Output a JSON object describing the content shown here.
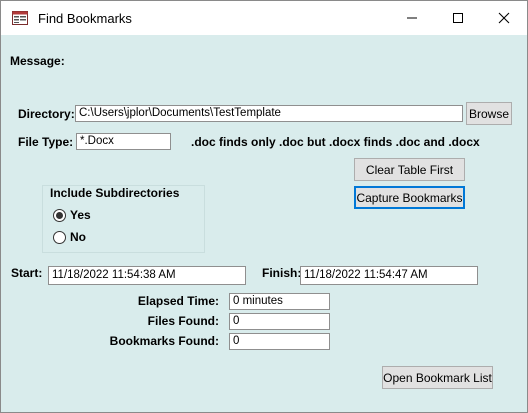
{
  "window": {
    "title": "Find Bookmarks"
  },
  "labels": {
    "message": "Message:",
    "directory": "Directory:",
    "file_type": "File Type:",
    "hint": ".doc finds only .doc but .docx finds .doc and .docx",
    "include_subdirectories": "Include Subdirectories",
    "yes": "Yes",
    "no": "No",
    "start": "Start:",
    "finish": "Finish:",
    "elapsed_time": "Elapsed Time:",
    "files_found": "Files Found:",
    "bookmarks_found": "Bookmarks Found:"
  },
  "fields": {
    "directory": "C:\\Users\\jplor\\Documents\\TestTemplate",
    "file_type": "*.Docx",
    "start": "11/18/2022 11:54:38 AM",
    "finish": "11/18/2022 11:54:47 AM",
    "elapsed_time": "0 minutes",
    "files_found": "0",
    "bookmarks_found": "0"
  },
  "buttons": {
    "browse": "Browse",
    "clear_table_first": "Clear Table First",
    "capture_bookmarks": "Capture Bookmarks",
    "open_bookmark_list": "Open Bookmark List"
  },
  "radio": {
    "selected": "Yes"
  }
}
